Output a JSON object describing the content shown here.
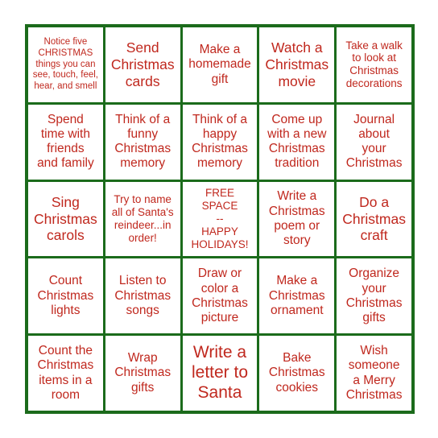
{
  "card": {
    "type": "bingo-card",
    "rows": 5,
    "columns": 5,
    "colors": {
      "grid_line": "#1b6b1b",
      "text": "#c0281e",
      "cell_background": "#ffffff",
      "page_background": "#ffffff"
    },
    "free_space_index": 12,
    "cells": [
      {
        "text": "Notice five\nCHRISTMAS\nthings you can\nsee, touch, feel,\nhear, and smell",
        "size": "xs"
      },
      {
        "text": "Send\nChristmas\ncards",
        "size": "l"
      },
      {
        "text": "Make a\nhomemade\ngift",
        "size": "m"
      },
      {
        "text": "Watch a\nChristmas\nmovie",
        "size": "l"
      },
      {
        "text": "Take a walk\nto look at\nChristmas\ndecorations",
        "size": "s"
      },
      {
        "text": "Spend\ntime with\nfriends\nand family",
        "size": "m"
      },
      {
        "text": "Think of a\nfunny\nChristmas\nmemory",
        "size": "m"
      },
      {
        "text": "Think of a\nhappy\nChristmas\nmemory",
        "size": "m"
      },
      {
        "text": "Come up\nwith a new\nChristmas\ntradition",
        "size": "m"
      },
      {
        "text": "Journal\nabout\nyour\nChristmas",
        "size": "m"
      },
      {
        "text": "Sing\nChristmas\ncarols",
        "size": "l"
      },
      {
        "text": "Try to name\nall of Santa's\nreindeer...in\norder!",
        "size": "s"
      },
      {
        "text": "FREE\nSPACE\n--\nHAPPY\nHOLIDAYS!",
        "size": "s"
      },
      {
        "text": "Write a\nChristmas\npoem or\nstory",
        "size": "m"
      },
      {
        "text": "Do a\nChristmas\ncraft",
        "size": "l"
      },
      {
        "text": "Count\nChristmas\nlights",
        "size": "m"
      },
      {
        "text": "Listen to\nChristmas\nsongs",
        "size": "m"
      },
      {
        "text": "Draw or\ncolor a\nChristmas\npicture",
        "size": "m"
      },
      {
        "text": "Make a\nChristmas\nornament",
        "size": "m"
      },
      {
        "text": "Organize\nyour\nChristmas\ngifts",
        "size": "m"
      },
      {
        "text": "Count the\nChristmas\nitems in a\nroom",
        "size": "m"
      },
      {
        "text": "Wrap\nChristmas\ngifts",
        "size": "m"
      },
      {
        "text": "Write a\nletter to\nSanta",
        "size": "xl"
      },
      {
        "text": "Bake\nChristmas\ncookies",
        "size": "m"
      },
      {
        "text": "Wish\nsomeone\na Merry\nChristmas",
        "size": "m"
      }
    ]
  }
}
